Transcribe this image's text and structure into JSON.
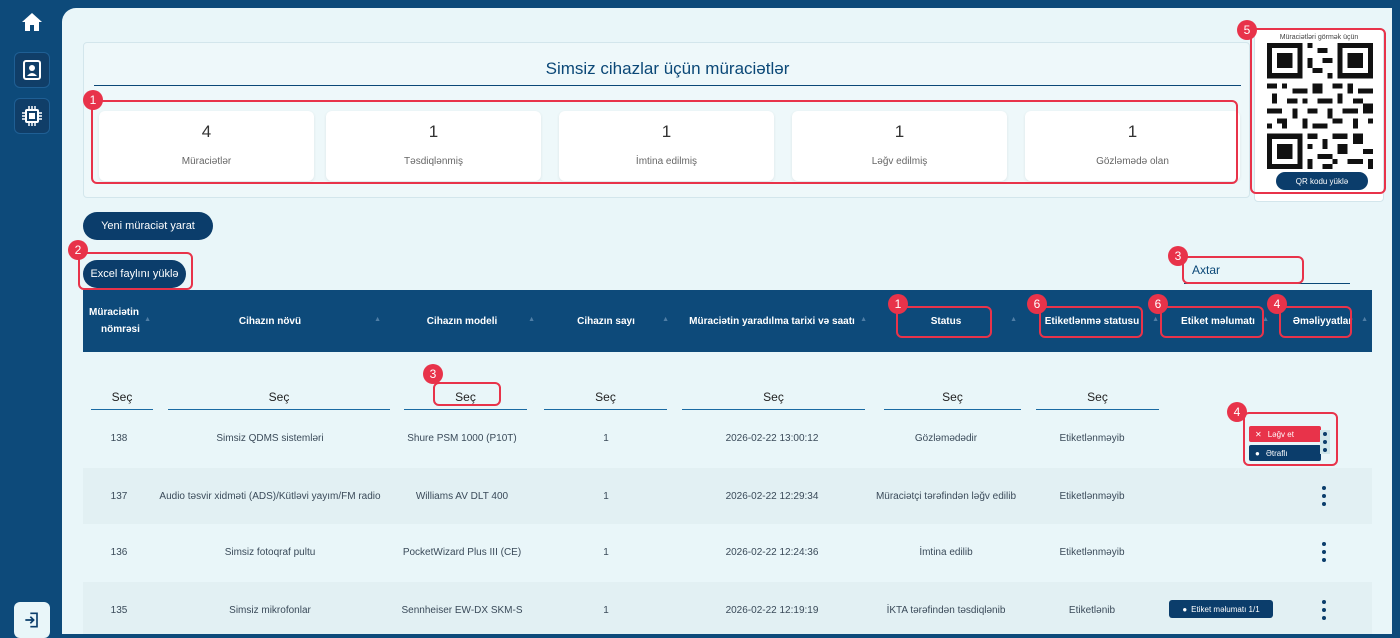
{
  "sidebar": {
    "icons": [
      "home-icon",
      "contact-card-icon",
      "chip-icon",
      "logout-icon"
    ]
  },
  "summary": {
    "title": "Simsiz cihazlar üçün müraciətlər",
    "stats": [
      {
        "value": "4",
        "label": "Müraciətlər"
      },
      {
        "value": "1",
        "label": "Təsdiqlənmiş"
      },
      {
        "value": "1",
        "label": "İmtina edilmiş"
      },
      {
        "value": "1",
        "label": "Ləğv edilmiş"
      },
      {
        "value": "1",
        "label": "Gözləmədə olan"
      }
    ]
  },
  "qr": {
    "caption": "Müraciətləri görmək üçün",
    "button": "QR kodu yüklə"
  },
  "actions": {
    "new_request": "Yeni müraciət yarat",
    "excel": "Excel faylını yüklə"
  },
  "search": {
    "placeholder": "Axtar"
  },
  "table": {
    "headers": [
      {
        "line1": "Müraciətin",
        "line2": "nömrəsi"
      },
      {
        "line1": "Cihazın növü",
        "line2": ""
      },
      {
        "line1": "Cihazın modeli",
        "line2": ""
      },
      {
        "line1": "Cihazın sayı",
        "line2": ""
      },
      {
        "line1": "Müraciətin yaradılma tarixi və saatı",
        "line2": ""
      },
      {
        "line1": "Status",
        "line2": ""
      },
      {
        "line1": "Etiketlənmə statusu",
        "line2": ""
      },
      {
        "line1": "Etiket məlumatı",
        "line2": ""
      },
      {
        "line1": "Əməliyyatlar",
        "line2": ""
      }
    ],
    "filter_label": "Seç",
    "rows": [
      {
        "id": "138",
        "type": "Simsiz QDMS sistemləri",
        "model": "Shure PSM 1000 (P10T)",
        "count": "1",
        "date": "2026-02-22 13:00:12",
        "status": "Gözləmədədir",
        "label_status": "Etiketlənməyib",
        "label_info": ""
      },
      {
        "id": "137",
        "type": "Audio təsvir xidməti (ADS)/Kütləvi yayım/FM radio",
        "model": "Williams AV DLT 400",
        "count": "1",
        "date": "2026-02-22 12:29:34",
        "status": "Müraciətçi tərəfindən ləğv edilib",
        "label_status": "Etiketlənməyib",
        "label_info": ""
      },
      {
        "id": "136",
        "type": "Simsiz fotoqraf pultu",
        "model": "PocketWizard Plus III (CE)",
        "count": "1",
        "date": "2026-02-22 12:24:36",
        "status": "İmtina edilib",
        "label_status": "Etiketlənməyib",
        "label_info": ""
      },
      {
        "id": "135",
        "type": "Simsiz mikrofonlar",
        "model": "Sennheiser EW-DX SKM-S",
        "count": "1",
        "date": "2026-02-22 12:19:19",
        "status": "İKTA tərəfindən təsdiqlənib",
        "label_status": "Etiketlənib",
        "label_info": "Etiket məlumatı 1/1"
      }
    ],
    "row_menu": {
      "cancel": "Ləğv et",
      "details": "Ətraflı"
    }
  },
  "annotations": [
    "1",
    "2",
    "3",
    "3",
    "1",
    "6",
    "6",
    "4",
    "4",
    "5"
  ],
  "colors": {
    "accent": "#0b3d6b",
    "annotation": "#e8334a",
    "background": "#e9f6f9"
  }
}
